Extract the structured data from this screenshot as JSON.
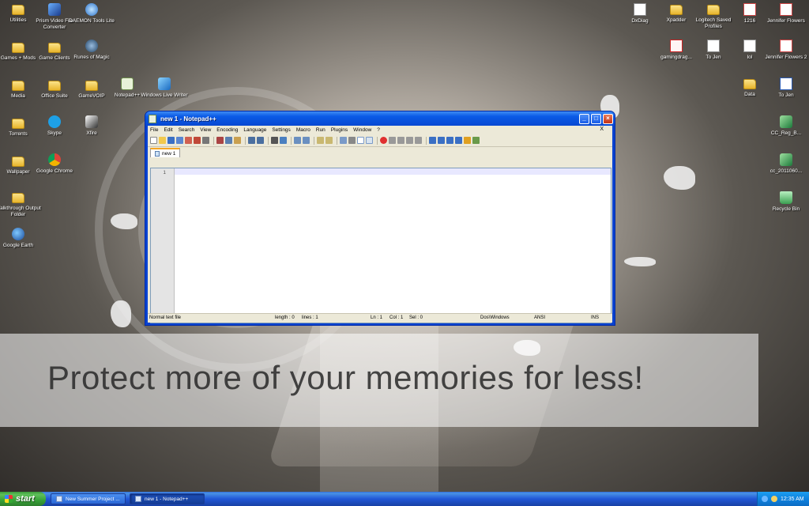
{
  "desktop_icons": {
    "utilities": "Utilities",
    "prism": "Prism Video File Converter",
    "daemon": "DAEMON Tools Lite",
    "games_mods": "Games + Mods",
    "game_clients": "Game Clients",
    "runes": "Runes of Magic",
    "media": "Media",
    "office": "Office Suite",
    "gamevoip": "GameVOIP",
    "notepadpp": "Notepad++",
    "wlw": "Windows Live Writer",
    "torrents": "Torrents",
    "skype": "Skype",
    "xfire": "Xfire",
    "wallpaper": "Wallpaper",
    "chrome": "Google Chrome",
    "walkthrough": "Walkthrough Output Folder",
    "earth": "Google Earth",
    "dxdiag": "DxDiag",
    "xpadder": "Xpadder",
    "logitech": "Logitech Saved Profiles",
    "f1216": "1216",
    "jennifer": "Jennifer Flowers",
    "gamingdrag": "gamingdrag...",
    "tojen1": "To Jen",
    "lol": "lol",
    "jennifer2": "Jennifer Flowers 2",
    "data": "Data",
    "tojen2": "To Jen",
    "ccreg": "CC_Reg_B...",
    "cc2011": "cc_2011060...",
    "recycle": "Recycle Bin"
  },
  "window": {
    "title": "new  1 - Notepad++",
    "menu": [
      "File",
      "Edit",
      "Search",
      "View",
      "Encoding",
      "Language",
      "Settings",
      "Macro",
      "Run",
      "Plugins",
      "Window",
      "?"
    ],
    "menu_close": "X",
    "tab_label": "new  1",
    "line_number": "1",
    "status": {
      "type": "Normal text file",
      "length": "length : 0",
      "lines": "lines : 1",
      "ln": "Ln : 1",
      "col": "Col : 1",
      "sel": "Sel : 0",
      "eol": "Dos\\Windows",
      "encoding": "ANSI",
      "mode": "INS"
    }
  },
  "watermark": "Protect more of your memories for less!",
  "taskbar": {
    "start": "start",
    "task1": "New Summer Project ...",
    "task2": "new  1 - Notepad++",
    "clock": "12:35 AM"
  },
  "colors": {
    "xp_blue": "#0a5ae6",
    "start_green": "#38a238",
    "tab_accent": "#f5a623"
  }
}
